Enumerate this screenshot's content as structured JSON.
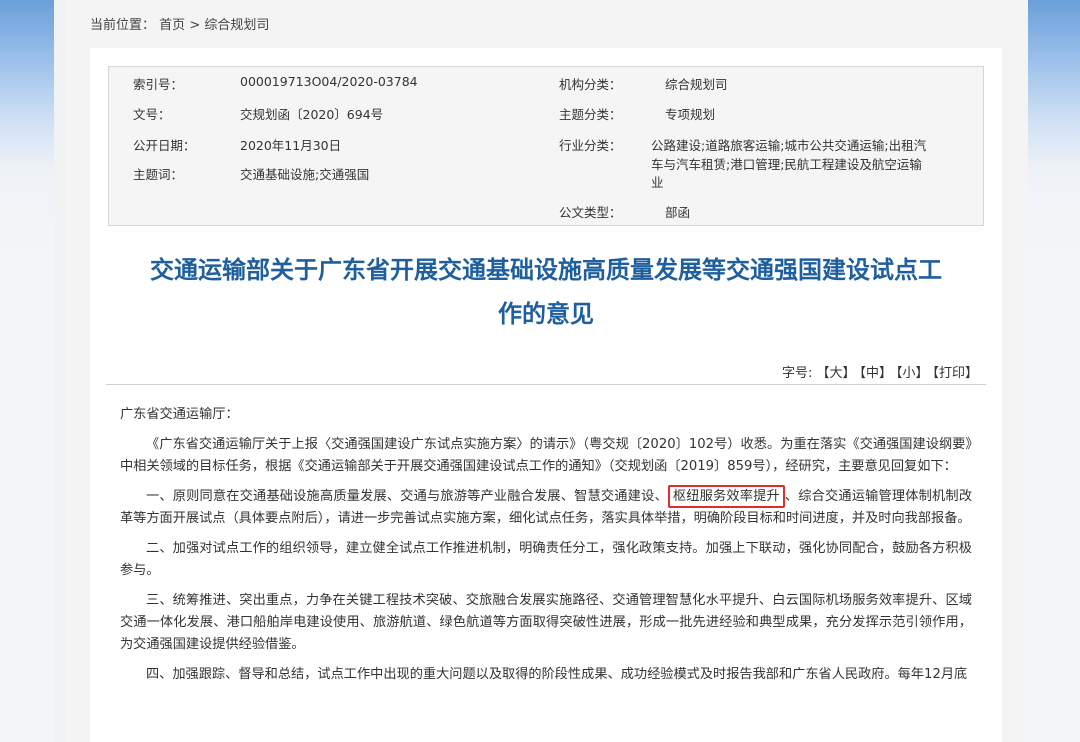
{
  "breadcrumb": {
    "prefix": "当前位置：",
    "home": "首页",
    "sep": ">",
    "current": "综合规划司"
  },
  "meta": {
    "index_label": "索引号：",
    "index_value": "000019713O04/2020-03784",
    "org_label": "机构分类：",
    "org_value": "综合规划司",
    "docno_label": "文号：",
    "docno_value": "交规划函〔2020〕694号",
    "topic_label": "主题分类：",
    "topic_value": "专项规划",
    "date_label": "公开日期：",
    "date_value": "2020年11月30日",
    "industry_label": "行业分类：",
    "industry_value_1": "公路建设;道路旅客运输;城市公共交通运输;出租汽",
    "industry_value_2": "车与汽车租赁;港口管理;民航工程建设及航空运输",
    "industry_value_3": "业",
    "keywords_label": "主题词：",
    "keywords_value": "交通基础设施;交通强国",
    "doctype_label": "公文类型：",
    "doctype_value": "部函"
  },
  "title": {
    "line1": "交通运输部关于广东省开展交通基础设施高质量发展等交通强国建设试点工",
    "line2": "作的意见"
  },
  "fontsize": {
    "label": "字号:",
    "large": "【大】",
    "medium": "【中】",
    "small": "【小】",
    "print": "【打印】"
  },
  "body": {
    "salutation": "广东省交通运输厅：",
    "p1": "《广东省交通运输厅关于上报〈交通强国建设广东试点实施方案〉的请示》（粤交规〔2020〕102号）收悉。为重在落实《交通强国建设纲要》中相关领域的目标任务，根据《交通运输部关于开展交通强国建设试点工作的通知》（交规划函〔2019〕859号），经研究，主要意见回复如下：",
    "p2_before": "一、原则同意在交通基础设施高质量发展、交通与旅游等产业融合发展、智慧交通建设、",
    "p2_highlight": "枢纽服务效率提升",
    "p2_after": "、综合交通运输管理体制机制改革等方面开展试点（具体要点附后），请进一步完善试点实施方案，细化试点任务，落实具体举措，明确阶段目标和时间进度，并及时向我部报备。",
    "p3": "二、加强对试点工作的组织领导，建立健全试点工作推进机制，明确责任分工，强化政策支持。加强上下联动，强化协同配合，鼓励各方积极参与。",
    "p4": "三、统筹推进、突出重点，力争在关键工程技术突破、交旅融合发展实施路径、交通管理智慧化水平提升、白云国际机场服务效率提升、区域交通一体化发展、港口船舶岸电建设使用、旅游航道、绿色航道等方面取得突破性进展，形成一批先进经验和典型成果，充分发挥示范引领作用，为交通强国建设提供经验借鉴。",
    "p5": "四、加强跟踪、督导和总结，试点工作中出现的重大问题以及取得的阶段性成果、成功经验模式及时报告我部和广东省人民政府。每年12月底"
  }
}
